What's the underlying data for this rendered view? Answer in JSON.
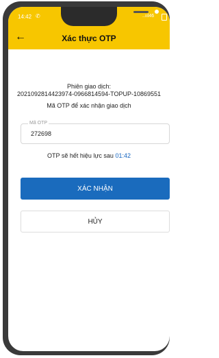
{
  "status_bar": {
    "time": "14:42",
    "phone_icon": "phone-call-icon",
    "signal": "..ııl46",
    "battery_icon": "battery-icon"
  },
  "header": {
    "back_icon": "arrow-left-icon",
    "title": "Xác thực OTP"
  },
  "transaction": {
    "label": "Phiên giao dịch:",
    "id": "2021092814423974-0966814594-TOPUP-10869551"
  },
  "otp_instruction": "Mã OTP để xác nhận giao dịch",
  "otp_field": {
    "label": "Mã OTP",
    "value": "272698"
  },
  "expiry": {
    "text": "OTP sẽ hết hiệu lực sau",
    "countdown": "01:42"
  },
  "buttons": {
    "confirm": "XÁC NHẬN",
    "cancel": "HỦY"
  },
  "colors": {
    "header": "#f7c600",
    "primary": "#1a6bbd",
    "countdown": "#1565c0"
  }
}
